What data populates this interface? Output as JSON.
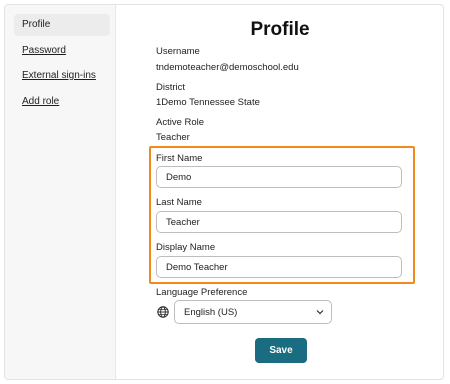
{
  "sidebar": {
    "items": [
      {
        "label": "Profile",
        "active": true
      },
      {
        "label": "Password",
        "active": false
      },
      {
        "label": "External sign-ins",
        "active": false
      },
      {
        "label": "Add role",
        "active": false
      }
    ]
  },
  "page": {
    "title": "Profile"
  },
  "info": {
    "username_label": "Username",
    "username_value": "tndemoteacher@demoschool.edu",
    "district_label": "District",
    "district_value": "1Demo Tennessee State",
    "role_label": "Active Role",
    "role_value": "Teacher"
  },
  "form": {
    "first_name_label": "First Name",
    "first_name_value": "Demo",
    "last_name_label": "Last Name",
    "last_name_value": "Teacher",
    "display_name_label": "Display Name",
    "display_name_value": "Demo Teacher",
    "language_label": "Language Preference",
    "language_value": "English (US)",
    "save_label": "Save"
  },
  "icons": {
    "globe": "globe-icon",
    "chevron": "chevron-down-icon"
  },
  "colors": {
    "highlight": "#f08a1c",
    "save_button": "#1a6c80",
    "sidebar_bg": "#f7f7f7"
  }
}
